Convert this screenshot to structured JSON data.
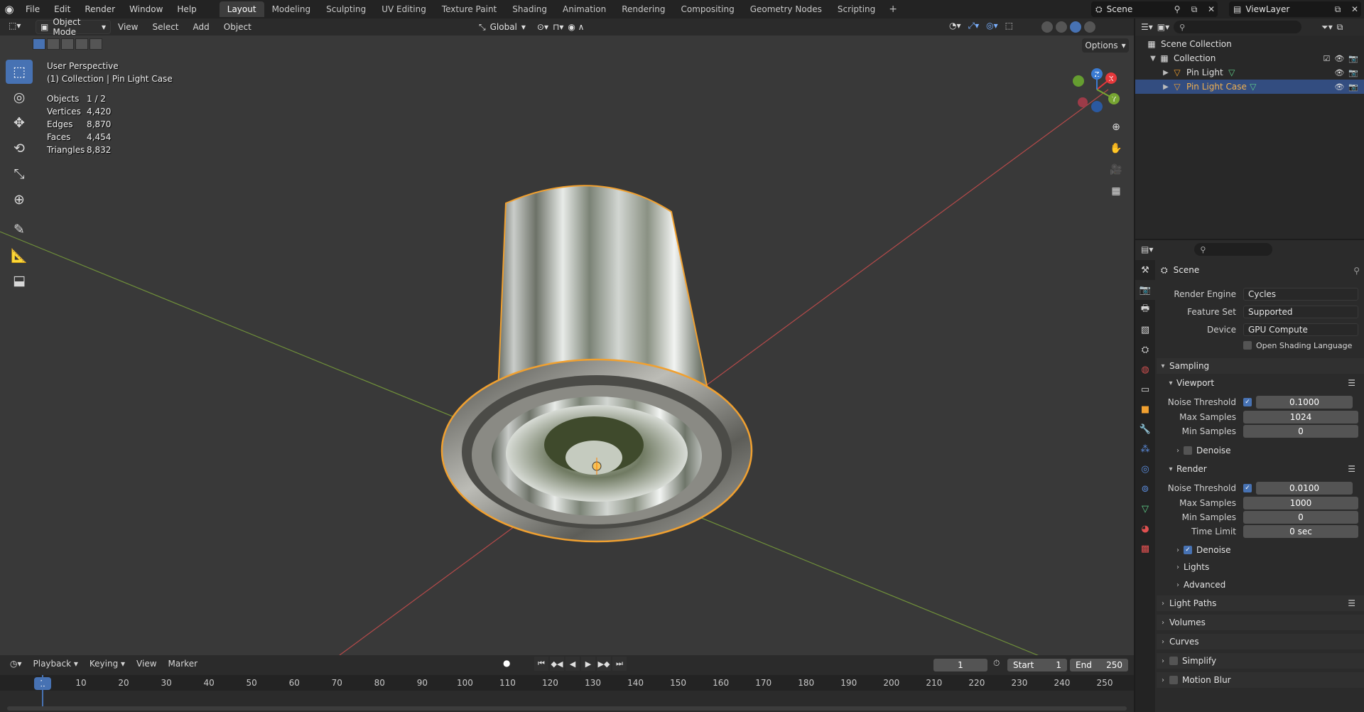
{
  "topbar": {
    "menus": [
      "File",
      "Edit",
      "Render",
      "Window",
      "Help"
    ],
    "workspaces": [
      "Layout",
      "Modeling",
      "Sculpting",
      "UV Editing",
      "Texture Paint",
      "Shading",
      "Animation",
      "Rendering",
      "Compositing",
      "Geometry Nodes",
      "Scripting"
    ],
    "active_workspace": "Layout",
    "add_tab": "+",
    "scene_name": "Scene",
    "view_layer": "ViewLayer"
  },
  "viewport": {
    "mode": "Object Mode",
    "menus": [
      "View",
      "Select",
      "Add",
      "Object"
    ],
    "orientation": "Global",
    "options_label": "Options",
    "perspective_label": "User Perspective",
    "collection_label": "(1) Collection | Pin Light Case",
    "stats": [
      {
        "key": "Objects",
        "value": "1 / 2"
      },
      {
        "key": "Vertices",
        "value": "4,420"
      },
      {
        "key": "Edges",
        "value": "8,870"
      },
      {
        "key": "Faces",
        "value": "4,454"
      },
      {
        "key": "Triangles",
        "value": "8,832"
      }
    ],
    "gizmo_axes": {
      "x": "X",
      "y": "Y",
      "z": "Z"
    },
    "colors": {
      "x_axis": "#e5383b",
      "y_axis": "#77a532",
      "z_axis": "#3b7bd1",
      "selection": "#f0a030"
    }
  },
  "timeline": {
    "menus": [
      "Playback",
      "Keying",
      "View",
      "Marker"
    ],
    "current_frame": "1",
    "start_label": "Start",
    "start_value": "1",
    "end_label": "End",
    "end_value": "250",
    "ticks": [
      "1",
      "10",
      "20",
      "30",
      "40",
      "50",
      "60",
      "70",
      "80",
      "90",
      "100",
      "110",
      "120",
      "130",
      "140",
      "150",
      "160",
      "170",
      "180",
      "190",
      "200",
      "210",
      "220",
      "230",
      "240",
      "250"
    ]
  },
  "outliner": {
    "scene_collection": "Scene Collection",
    "collection": "Collection",
    "objects": [
      {
        "name": "Pin Light",
        "selected": false
      },
      {
        "name": "Pin Light Case",
        "selected": true
      }
    ]
  },
  "properties": {
    "context": "Scene",
    "render_engine_label": "Render Engine",
    "render_engine": "Cycles",
    "feature_set_label": "Feature Set",
    "feature_set": "Supported",
    "device_label": "Device",
    "device": "GPU Compute",
    "osl_label": "Open Shading Language",
    "sampling": "Sampling",
    "viewport_sub": "Viewport",
    "vp_noise_label": "Noise Threshold",
    "vp_noise": "0.1000",
    "vp_max_label": "Max Samples",
    "vp_max": "1024",
    "vp_min_label": "Min Samples",
    "vp_min": "0",
    "vp_denoise": "Denoise",
    "render_sub": "Render",
    "r_noise_label": "Noise Threshold",
    "r_noise": "0.0100",
    "r_max_label": "Max Samples",
    "r_max": "1000",
    "r_min_label": "Min Samples",
    "r_min": "0",
    "r_time_label": "Time Limit",
    "r_time": "0 sec",
    "r_denoise": "Denoise",
    "lights": "Lights",
    "advanced": "Advanced",
    "light_paths": "Light Paths",
    "volumes": "Volumes",
    "curves": "Curves",
    "simplify": "Simplify",
    "motion_blur": "Motion Blur"
  }
}
